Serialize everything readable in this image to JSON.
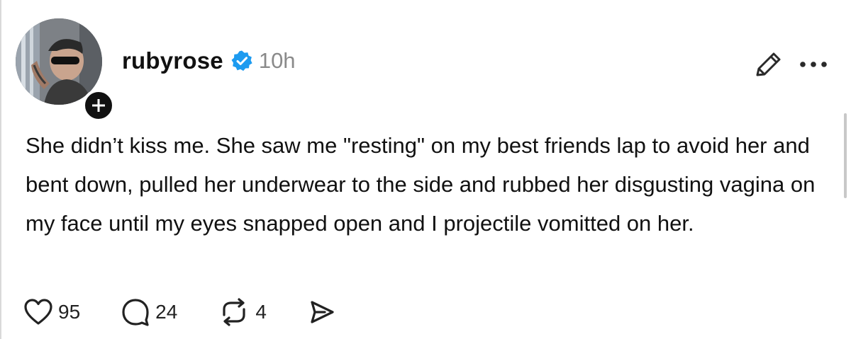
{
  "post": {
    "author": {
      "username": "rubyrose",
      "verified": true,
      "avatar_icon": "profile-photo"
    },
    "timestamp": "10h",
    "text": "She didn’t kiss me. She saw me \"resting\" on my best friends lap to avoid her and bent down, pulled her underwear to the side and rubbed her disgusting vagina on my face until my eyes snapped open and I projectile vomitted on her.",
    "actions": {
      "likes": "95",
      "replies": "24",
      "reposts": "4"
    }
  },
  "icons": {
    "follow": "plus-icon",
    "verified": "verified-badge-icon",
    "edit": "pencil-icon",
    "more": "more-horizontal-icon",
    "like": "heart-icon",
    "reply": "comment-icon",
    "repost": "repost-icon",
    "share": "send-icon"
  },
  "colors": {
    "verified": "#1D9BF0",
    "text": "#111111",
    "muted": "#8A8A8A"
  }
}
